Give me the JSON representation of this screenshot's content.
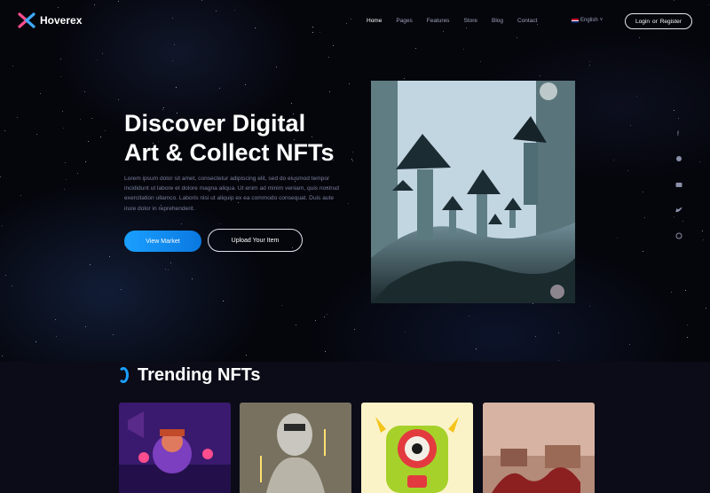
{
  "brand": {
    "name": "Hoverex",
    "accent": "#1aa0ff",
    "logo_colors": [
      "#ff4d8d",
      "#3fa9ff"
    ]
  },
  "nav": {
    "items": [
      {
        "label": "Home",
        "active": true
      },
      {
        "label": "Pages",
        "active": false
      },
      {
        "label": "Features",
        "active": false
      },
      {
        "label": "Store",
        "active": false
      },
      {
        "label": "Blog",
        "active": false
      },
      {
        "label": "Contact",
        "active": false
      }
    ],
    "language": {
      "label": "English",
      "icon": "uk-flag-icon",
      "chevron": "chevron-down-icon"
    },
    "auth": {
      "login_label": "Login",
      "separator": "or",
      "register_label": "Register"
    }
  },
  "hero": {
    "title_line1": "Discover Digital",
    "title_line2": "Art & Collect NFTs",
    "description": "Lorem ipsum dolor sit amet, consectetur adipiscing elit, sed do eiusmod tempor incididunt ut labore et dolore magna aliqua. Ut enim ad minim veniam, quis nostrud exercitation ullamco. Laboris nisi ut aliquip ex ea commodo consequat. Duis aute irure dolor in reprehenderit.",
    "primary_button": "View Market",
    "secondary_button": "Upload Your Item"
  },
  "social": [
    {
      "name": "facebook-icon"
    },
    {
      "name": "reddit-icon"
    },
    {
      "name": "youtube-icon"
    },
    {
      "name": "twitter-icon"
    },
    {
      "name": "dribbble-icon"
    }
  ],
  "trending": {
    "title": "Trending NFTs"
  }
}
